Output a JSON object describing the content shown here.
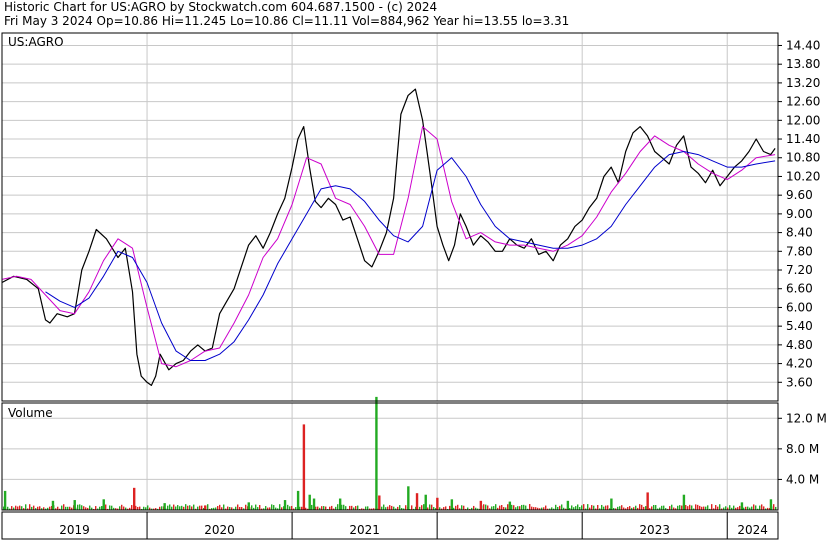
{
  "header": {
    "line1": "Historic Chart for US:AGRO by Stockwatch.com 604.687.1500 - (c) 2024",
    "line2": "Fri May  3 2024  Op=10.86  Hi=11.245  Lo=10.86  Cl=11.11  Vol=884,962  Year hi=13.55  lo=3.31"
  },
  "colors": {
    "price": "#000000",
    "ma_short": "#cc00cc",
    "ma_long": "#0000cc",
    "vol_up": "#22aa22",
    "vol_down": "#dd2222",
    "grid": "#c8c8c8"
  },
  "chart_data": {
    "type": "line",
    "price_panel": {
      "label": "US:AGRO",
      "ylim": [
        3.0,
        14.8
      ],
      "yticks": [
        "14.40",
        "13.80",
        "13.20",
        "12.60",
        "12.00",
        "11.40",
        "10.80",
        "10.20",
        "9.60",
        "9.00",
        "8.40",
        "7.80",
        "7.20",
        "6.60",
        "6.00",
        "5.40",
        "4.80",
        "4.20",
        "3.60"
      ],
      "xlim": [
        2019.0,
        2024.35
      ],
      "x_labels": [
        "2019",
        "2020",
        "2021",
        "2022",
        "2023",
        "2024"
      ],
      "series": [
        {
          "key": "price",
          "x": [
            2019.0,
            2019.08,
            2019.17,
            2019.25,
            2019.3,
            2019.33,
            2019.38,
            2019.45,
            2019.5,
            2019.55,
            2019.6,
            2019.65,
            2019.72,
            2019.8,
            2019.85,
            2019.9,
            2019.93,
            2019.96,
            2020.0,
            2020.03,
            2020.06,
            2020.09,
            2020.15,
            2020.2,
            2020.25,
            2020.3,
            2020.35,
            2020.4,
            2020.45,
            2020.5,
            2020.55,
            2020.6,
            2020.65,
            2020.7,
            2020.75,
            2020.8,
            2020.85,
            2020.9,
            2020.95,
            2021.0,
            2021.04,
            2021.08,
            2021.12,
            2021.16,
            2021.2,
            2021.25,
            2021.3,
            2021.35,
            2021.4,
            2021.45,
            2021.5,
            2021.55,
            2021.6,
            2021.65,
            2021.7,
            2021.75,
            2021.8,
            2021.85,
            2021.9,
            2021.93,
            2021.96,
            2022.0,
            2022.04,
            2022.08,
            2022.12,
            2022.16,
            2022.2,
            2022.25,
            2022.3,
            2022.35,
            2022.4,
            2022.45,
            2022.5,
            2022.55,
            2022.6,
            2022.65,
            2022.7,
            2022.75,
            2022.8,
            2022.85,
            2022.9,
            2022.95,
            2023.0,
            2023.05,
            2023.1,
            2023.15,
            2023.2,
            2023.25,
            2023.3,
            2023.35,
            2023.4,
            2023.45,
            2023.5,
            2023.55,
            2023.6,
            2023.65,
            2023.7,
            2023.75,
            2023.8,
            2023.85,
            2023.9,
            2023.95,
            2024.0,
            2024.05,
            2024.1,
            2024.15,
            2024.2,
            2024.25,
            2024.3,
            2024.33
          ],
          "y": [
            6.8,
            7.0,
            6.9,
            6.6,
            5.6,
            5.5,
            5.8,
            5.7,
            5.8,
            7.2,
            7.8,
            8.5,
            8.2,
            7.6,
            7.9,
            6.5,
            4.5,
            3.8,
            3.6,
            3.5,
            3.8,
            4.5,
            4.0,
            4.2,
            4.3,
            4.6,
            4.8,
            4.6,
            4.7,
            5.8,
            6.2,
            6.6,
            7.3,
            8.0,
            8.3,
            7.9,
            8.4,
            9.0,
            9.5,
            10.5,
            11.4,
            11.8,
            10.5,
            9.4,
            9.2,
            9.5,
            9.3,
            8.8,
            8.9,
            8.2,
            7.5,
            7.3,
            7.8,
            8.4,
            9.5,
            12.2,
            12.8,
            13.0,
            12.0,
            11.0,
            10.0,
            8.6,
            8.0,
            7.5,
            8.0,
            9.0,
            8.6,
            8.0,
            8.3,
            8.1,
            7.8,
            7.8,
            8.2,
            8.0,
            7.9,
            8.2,
            7.7,
            7.8,
            7.5,
            8.0,
            8.2,
            8.6,
            8.8,
            9.2,
            9.5,
            10.2,
            10.5,
            10.0,
            11.0,
            11.6,
            11.8,
            11.5,
            11.0,
            10.8,
            10.6,
            11.2,
            11.5,
            10.5,
            10.3,
            10.0,
            10.4,
            9.9,
            10.2,
            10.5,
            10.7,
            11.0,
            11.4,
            11.0,
            10.9,
            11.1
          ]
        },
        {
          "key": "ma_short",
          "x": [
            2019.0,
            2019.1,
            2019.2,
            2019.3,
            2019.4,
            2019.5,
            2019.6,
            2019.7,
            2019.8,
            2019.9,
            2020.0,
            2020.1,
            2020.2,
            2020.3,
            2020.4,
            2020.5,
            2020.6,
            2020.7,
            2020.8,
            2020.9,
            2021.0,
            2021.1,
            2021.2,
            2021.3,
            2021.4,
            2021.5,
            2021.6,
            2021.7,
            2021.8,
            2021.9,
            2022.0,
            2022.1,
            2022.2,
            2022.3,
            2022.4,
            2022.5,
            2022.6,
            2022.7,
            2022.8,
            2022.9,
            2023.0,
            2023.1,
            2023.2,
            2023.3,
            2023.4,
            2023.5,
            2023.6,
            2023.7,
            2023.8,
            2023.9,
            2024.0,
            2024.1,
            2024.2,
            2024.33
          ],
          "y": [
            6.9,
            7.0,
            6.9,
            6.4,
            5.9,
            5.8,
            6.5,
            7.5,
            8.2,
            7.9,
            6.0,
            4.2,
            4.1,
            4.3,
            4.6,
            4.7,
            5.5,
            6.4,
            7.6,
            8.2,
            9.3,
            10.8,
            10.6,
            9.5,
            9.3,
            8.6,
            7.7,
            7.7,
            9.5,
            11.8,
            11.4,
            9.4,
            8.2,
            8.4,
            8.1,
            8.0,
            8.0,
            7.9,
            7.8,
            8.0,
            8.3,
            8.9,
            9.7,
            10.3,
            11.0,
            11.5,
            11.2,
            11.0,
            10.6,
            10.3,
            10.1,
            10.4,
            10.8,
            10.9
          ]
        },
        {
          "key": "ma_long",
          "x": [
            2019.3,
            2019.4,
            2019.5,
            2019.6,
            2019.7,
            2019.8,
            2019.9,
            2020.0,
            2020.1,
            2020.2,
            2020.3,
            2020.4,
            2020.5,
            2020.6,
            2020.7,
            2020.8,
            2020.9,
            2021.0,
            2021.1,
            2021.2,
            2021.3,
            2021.4,
            2021.5,
            2021.6,
            2021.7,
            2021.8,
            2021.9,
            2022.0,
            2022.1,
            2022.2,
            2022.3,
            2022.4,
            2022.5,
            2022.6,
            2022.7,
            2022.8,
            2022.9,
            2023.0,
            2023.1,
            2023.2,
            2023.3,
            2023.4,
            2023.5,
            2023.6,
            2023.7,
            2023.8,
            2023.9,
            2024.0,
            2024.1,
            2024.2,
            2024.33
          ],
          "y": [
            6.5,
            6.2,
            6.0,
            6.3,
            7.0,
            7.8,
            7.6,
            6.8,
            5.5,
            4.6,
            4.3,
            4.3,
            4.5,
            4.9,
            5.6,
            6.4,
            7.4,
            8.2,
            9.0,
            9.8,
            9.9,
            9.8,
            9.4,
            8.8,
            8.3,
            8.1,
            8.6,
            10.4,
            10.8,
            10.2,
            9.3,
            8.6,
            8.2,
            8.1,
            8.0,
            7.9,
            7.9,
            8.0,
            8.2,
            8.6,
            9.3,
            9.9,
            10.5,
            10.9,
            11.0,
            10.9,
            10.7,
            10.5,
            10.5,
            10.6,
            10.7
          ]
        }
      ]
    },
    "volume_panel": {
      "label": "Volume",
      "ylim": [
        0,
        14.0
      ],
      "yticks": [
        "12.0 M",
        "8.0 M",
        "4.0 M"
      ],
      "bars": [
        {
          "x": 2019.02,
          "v": 2.5,
          "up": true
        },
        {
          "x": 2019.35,
          "v": 1.2,
          "up": true
        },
        {
          "x": 2019.5,
          "v": 1.3,
          "up": true
        },
        {
          "x": 2019.7,
          "v": 1.4,
          "up": true
        },
        {
          "x": 2019.91,
          "v": 2.9,
          "up": false
        },
        {
          "x": 2020.12,
          "v": 0.9,
          "up": true
        },
        {
          "x": 2020.4,
          "v": 0.6,
          "up": false
        },
        {
          "x": 2020.7,
          "v": 1.0,
          "up": true
        },
        {
          "x": 2020.95,
          "v": 1.3,
          "up": true
        },
        {
          "x": 2021.04,
          "v": 2.5,
          "up": true
        },
        {
          "x": 2021.08,
          "v": 11.2,
          "up": false
        },
        {
          "x": 2021.12,
          "v": 2.0,
          "up": true
        },
        {
          "x": 2021.15,
          "v": 1.5,
          "up": true
        },
        {
          "x": 2021.33,
          "v": 1.5,
          "up": true
        },
        {
          "x": 2021.58,
          "v": 14.8,
          "up": true
        },
        {
          "x": 2021.6,
          "v": 1.9,
          "up": false
        },
        {
          "x": 2021.8,
          "v": 3.1,
          "up": true
        },
        {
          "x": 2021.86,
          "v": 2.2,
          "up": false
        },
        {
          "x": 2021.92,
          "v": 2.0,
          "up": true
        },
        {
          "x": 2022.0,
          "v": 1.6,
          "up": false
        },
        {
          "x": 2022.1,
          "v": 1.4,
          "up": true
        },
        {
          "x": 2022.3,
          "v": 1.2,
          "up": false
        },
        {
          "x": 2022.5,
          "v": 1.1,
          "up": true
        },
        {
          "x": 2022.9,
          "v": 1.2,
          "up": true
        },
        {
          "x": 2023.2,
          "v": 1.5,
          "up": true
        },
        {
          "x": 2023.45,
          "v": 2.3,
          "up": false
        },
        {
          "x": 2023.7,
          "v": 2.0,
          "up": true
        },
        {
          "x": 2024.1,
          "v": 1.0,
          "up": true
        },
        {
          "x": 2024.3,
          "v": 1.4,
          "up": true
        }
      ]
    }
  }
}
